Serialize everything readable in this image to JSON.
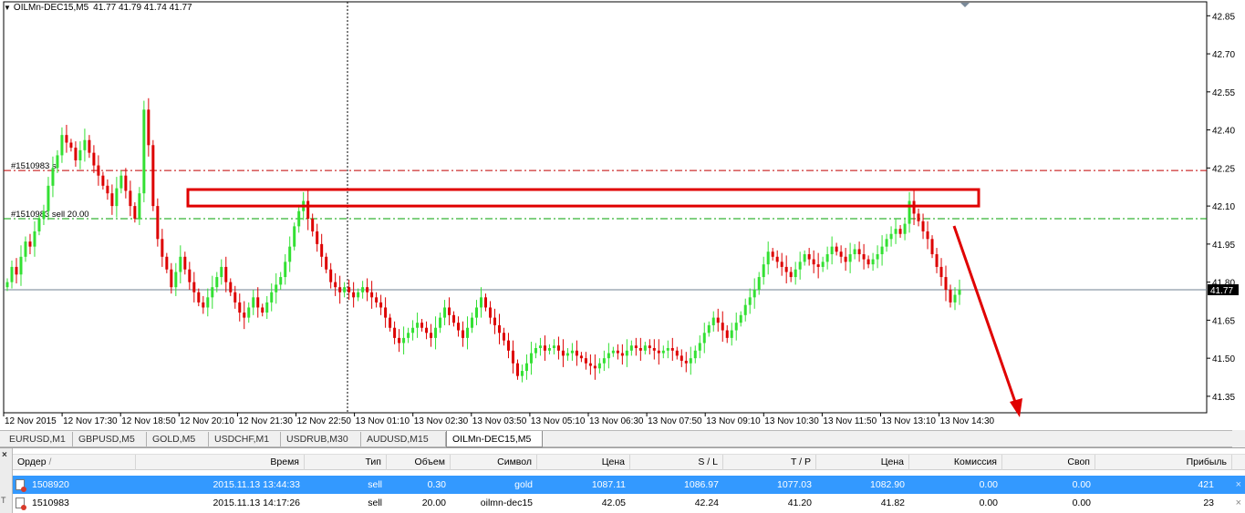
{
  "chart": {
    "symbol": "OILMn-DEC15,M5",
    "ohlc": "41.77 41.79 41.74 41.77",
    "y_ticks": [
      "42.85",
      "42.70",
      "42.55",
      "42.40",
      "42.25",
      "42.10",
      "41.95",
      "41.80",
      "41.65",
      "41.50",
      "41.35"
    ],
    "y_tick_values": [
      42.85,
      42.7,
      42.55,
      42.4,
      42.25,
      42.1,
      41.95,
      41.8,
      41.65,
      41.5,
      41.35
    ],
    "x_ticks": [
      "12 Nov 2015",
      "12 Nov 17:30",
      "12 Nov 18:50",
      "12 Nov 20:10",
      "12 Nov 21:30",
      "12 Nov 22:50",
      "13 Nov 01:10",
      "13 Nov 02:30",
      "13 Nov 03:50",
      "13 Nov 05:10",
      "13 Nov 06:30",
      "13 Nov 07:50",
      "13 Nov 09:10",
      "13 Nov 10:30",
      "13 Nov 11:50",
      "13 Nov 13:10",
      "13 Nov 14:30"
    ],
    "current_price": "41.77",
    "current_price_value": 41.77,
    "sl_line": {
      "label": "#1510983 sl",
      "value": 42.24
    },
    "order_line": {
      "label": "#1510983 sell 20.00",
      "value": 42.05
    },
    "colors": {
      "bull": "#33e033",
      "bear": "#dd0000",
      "sl": "#c00000",
      "order": "#00a000",
      "price_line": "#708090",
      "annotation": "#e00000"
    }
  },
  "chart_data": {
    "type": "candlestick",
    "symbol": "OILMn-DEC15,M5",
    "ylim": [
      41.3,
      42.9
    ],
    "series": [
      {
        "values": [
          41.8,
          41.86,
          41.83,
          41.9,
          41.96,
          41.94,
          42.0,
          42.05,
          42.08,
          42.18,
          42.25,
          42.3,
          42.38,
          42.35,
          42.33,
          42.28,
          42.32,
          42.36,
          42.31,
          42.26,
          42.22,
          42.18,
          42.15,
          42.1,
          42.17,
          42.22,
          42.16,
          42.1,
          42.05,
          42.15,
          42.48,
          42.34,
          42.1,
          41.97,
          41.9,
          41.85,
          41.78,
          41.84,
          41.9,
          41.85,
          41.8,
          41.76,
          41.72,
          41.7,
          41.74,
          41.78,
          41.82,
          41.86,
          41.8,
          41.76,
          41.72,
          41.68,
          41.66,
          41.7,
          41.74,
          41.7,
          41.68,
          41.72,
          41.76,
          41.79,
          41.82,
          41.88,
          41.94,
          42.02,
          42.08,
          42.12,
          42.05,
          42.0,
          41.95,
          41.9,
          41.85,
          41.8,
          41.78,
          41.76,
          41.78,
          41.76,
          41.74,
          41.76,
          41.78,
          41.76,
          41.74,
          41.72,
          41.7,
          41.66,
          41.62,
          41.58,
          41.56,
          41.58,
          41.6,
          41.62,
          41.64,
          41.62,
          41.6,
          41.58,
          41.62,
          41.66,
          41.7,
          41.67,
          41.64,
          41.61,
          41.58,
          41.62,
          41.66,
          41.7,
          41.74,
          41.7,
          41.66,
          41.63,
          41.6,
          41.57,
          41.53,
          41.48,
          41.43,
          41.45,
          41.48,
          41.52,
          41.54,
          41.55,
          41.53,
          41.54,
          41.55,
          41.53,
          41.51,
          41.52,
          41.53,
          41.51,
          41.5,
          41.48,
          41.47,
          41.46,
          41.48,
          41.5,
          41.52,
          41.53,
          41.52,
          41.51,
          41.53,
          41.55,
          41.54,
          41.53,
          41.55,
          41.54,
          41.53,
          41.52,
          41.53,
          41.54,
          41.53,
          41.51,
          41.49,
          41.48,
          41.5,
          41.53,
          41.56,
          41.6,
          41.63,
          41.66,
          41.64,
          41.61,
          41.58,
          41.61,
          41.64,
          41.67,
          41.71,
          41.74,
          41.77,
          41.82,
          41.87,
          41.92,
          41.9,
          41.88,
          41.86,
          41.84,
          41.82,
          41.85,
          41.88,
          41.91,
          41.89,
          41.87,
          41.86,
          41.88,
          41.91,
          41.94,
          41.92,
          41.9,
          41.88,
          41.91,
          41.93,
          41.91,
          41.89,
          41.87,
          41.89,
          41.91,
          41.94,
          41.97,
          41.99,
          42.01,
          41.99,
          42.03,
          42.12,
          42.07,
          42.04,
          42.0,
          41.97,
          41.91,
          41.86,
          41.82,
          41.77,
          41.72,
          41.75,
          41.77
        ]
      }
    ]
  },
  "tabs": [
    "EURUSD,M1",
    "GBPUSD,M5",
    "GOLD,M5",
    "USDCHF,M1",
    "USDRUB,M30",
    "AUDUSD,M15",
    "OILMn-DEC15,M5"
  ],
  "active_tab": 6,
  "terminal": {
    "close_label": "×",
    "side_label": "Т",
    "headers": {
      "order": "Ордер",
      "time": "Время",
      "type": "Тип",
      "volume": "Объем",
      "symbol": "Символ",
      "price": "Цена",
      "sl": "S / L",
      "tp": "T / P",
      "price2": "Цена",
      "commission": "Комиссия",
      "swap": "Своп",
      "profit": "Прибыль"
    },
    "rows": [
      {
        "order": "1508920",
        "time": "2015.11.13 13:44:33",
        "type": "sell",
        "volume": "0.30",
        "symbol": "gold",
        "price": "1087.11",
        "sl": "1086.97",
        "tp": "1077.03",
        "price2": "1082.90",
        "commission": "0.00",
        "swap": "0.00",
        "profit": "421",
        "selected": true
      },
      {
        "order": "1510983",
        "time": "2015.11.13 14:17:26",
        "type": "sell",
        "volume": "20.00",
        "symbol": "oilmn-dec15",
        "price": "42.05",
        "sl": "42.24",
        "tp": "41.20",
        "price2": "41.82",
        "commission": "0.00",
        "swap": "0.00",
        "profit": "23",
        "selected": false
      }
    ],
    "row_close": "×"
  }
}
